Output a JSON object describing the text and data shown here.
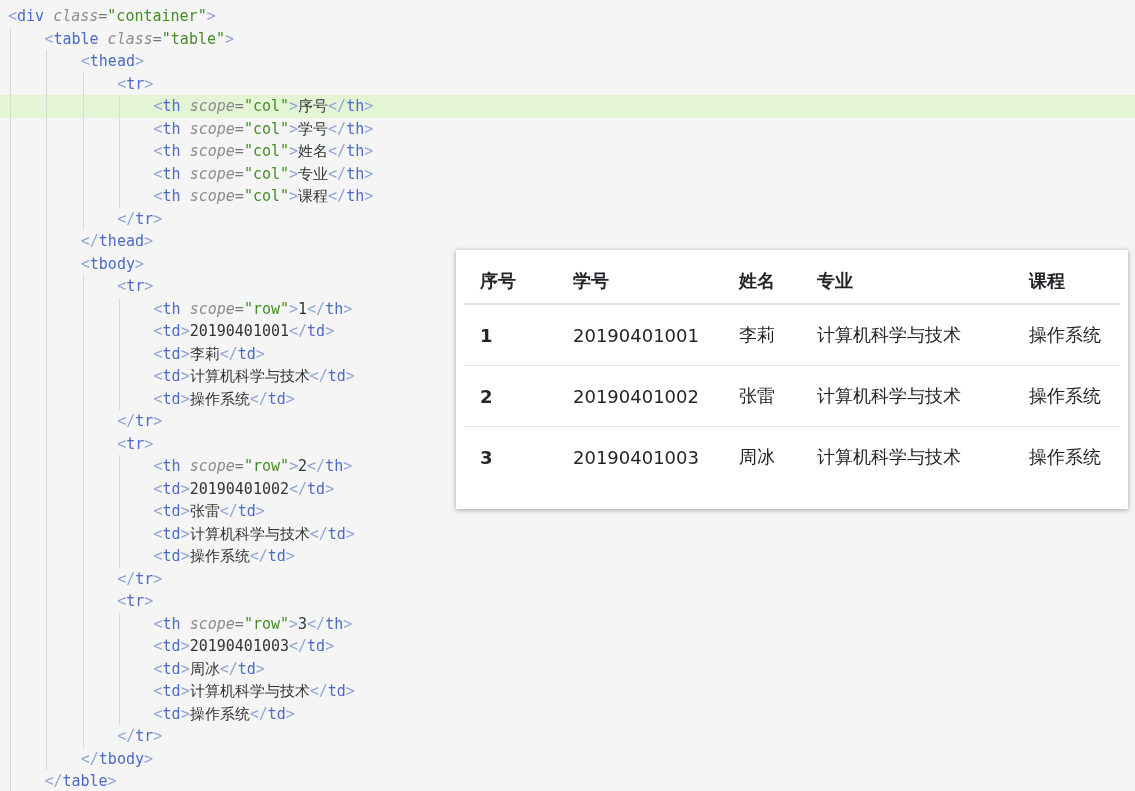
{
  "editor": {
    "lines": [
      {
        "highlighted": false,
        "tokens": [
          {
            "kind": "bracket",
            "text": "<"
          },
          {
            "kind": "tag",
            "text": "div"
          },
          {
            "kind": "attr",
            "text": " class"
          },
          {
            "kind": "eq",
            "text": "="
          },
          {
            "kind": "string",
            "text": "\"container\""
          },
          {
            "kind": "bracket",
            "text": ">"
          }
        ],
        "children": [
          {
            "highlighted": false,
            "tokens": [
              {
                "kind": "bracket",
                "text": "<"
              },
              {
                "kind": "tag",
                "text": "table"
              },
              {
                "kind": "attr",
                "text": " class"
              },
              {
                "kind": "eq",
                "text": "="
              },
              {
                "kind": "string",
                "text": "\"table\""
              },
              {
                "kind": "bracket",
                "text": ">"
              }
            ],
            "children": [
              {
                "highlighted": false,
                "tokens": [
                  {
                    "kind": "bracket",
                    "text": "<"
                  },
                  {
                    "kind": "tag",
                    "text": "thead"
                  },
                  {
                    "kind": "bracket",
                    "text": ">"
                  }
                ],
                "children": [
                  {
                    "highlighted": false,
                    "tokens": [
                      {
                        "kind": "bracket",
                        "text": "<"
                      },
                      {
                        "kind": "tag",
                        "text": "tr"
                      },
                      {
                        "kind": "bracket",
                        "text": ">"
                      }
                    ],
                    "children": [
                      {
                        "highlighted": true,
                        "tokens": [
                          {
                            "kind": "bracket",
                            "text": "<"
                          },
                          {
                            "kind": "tag",
                            "text": "th"
                          },
                          {
                            "kind": "attr",
                            "text": " scope"
                          },
                          {
                            "kind": "eq",
                            "text": "="
                          },
                          {
                            "kind": "string",
                            "text": "\"col\""
                          },
                          {
                            "kind": "bracket",
                            "text": ">"
                          },
                          {
                            "kind": "text",
                            "text": "序号"
                          },
                          {
                            "kind": "bracket",
                            "text": "</"
                          },
                          {
                            "kind": "tag",
                            "text": "th"
                          },
                          {
                            "kind": "bracket",
                            "text": ">"
                          }
                        ]
                      },
                      {
                        "highlighted": false,
                        "tokens": [
                          {
                            "kind": "bracket",
                            "text": "<"
                          },
                          {
                            "kind": "tag",
                            "text": "th"
                          },
                          {
                            "kind": "attr",
                            "text": " scope"
                          },
                          {
                            "kind": "eq",
                            "text": "="
                          },
                          {
                            "kind": "string",
                            "text": "\"col\""
                          },
                          {
                            "kind": "bracket",
                            "text": ">"
                          },
                          {
                            "kind": "text",
                            "text": "学号"
                          },
                          {
                            "kind": "bracket",
                            "text": "</"
                          },
                          {
                            "kind": "tag",
                            "text": "th"
                          },
                          {
                            "kind": "bracket",
                            "text": ">"
                          }
                        ]
                      },
                      {
                        "highlighted": false,
                        "tokens": [
                          {
                            "kind": "bracket",
                            "text": "<"
                          },
                          {
                            "kind": "tag",
                            "text": "th"
                          },
                          {
                            "kind": "attr",
                            "text": " scope"
                          },
                          {
                            "kind": "eq",
                            "text": "="
                          },
                          {
                            "kind": "string",
                            "text": "\"col\""
                          },
                          {
                            "kind": "bracket",
                            "text": ">"
                          },
                          {
                            "kind": "text",
                            "text": "姓名"
                          },
                          {
                            "kind": "bracket",
                            "text": "</"
                          },
                          {
                            "kind": "tag",
                            "text": "th"
                          },
                          {
                            "kind": "bracket",
                            "text": ">"
                          }
                        ]
                      },
                      {
                        "highlighted": false,
                        "tokens": [
                          {
                            "kind": "bracket",
                            "text": "<"
                          },
                          {
                            "kind": "tag",
                            "text": "th"
                          },
                          {
                            "kind": "attr",
                            "text": " scope"
                          },
                          {
                            "kind": "eq",
                            "text": "="
                          },
                          {
                            "kind": "string",
                            "text": "\"col\""
                          },
                          {
                            "kind": "bracket",
                            "text": ">"
                          },
                          {
                            "kind": "text",
                            "text": "专业"
                          },
                          {
                            "kind": "bracket",
                            "text": "</"
                          },
                          {
                            "kind": "tag",
                            "text": "th"
                          },
                          {
                            "kind": "bracket",
                            "text": ">"
                          }
                        ]
                      },
                      {
                        "highlighted": false,
                        "tokens": [
                          {
                            "kind": "bracket",
                            "text": "<"
                          },
                          {
                            "kind": "tag",
                            "text": "th"
                          },
                          {
                            "kind": "attr",
                            "text": " scope"
                          },
                          {
                            "kind": "eq",
                            "text": "="
                          },
                          {
                            "kind": "string",
                            "text": "\"col\""
                          },
                          {
                            "kind": "bracket",
                            "text": ">"
                          },
                          {
                            "kind": "text",
                            "text": "课程"
                          },
                          {
                            "kind": "bracket",
                            "text": "</"
                          },
                          {
                            "kind": "tag",
                            "text": "th"
                          },
                          {
                            "kind": "bracket",
                            "text": ">"
                          }
                        ]
                      }
                    ]
                  },
                  {
                    "highlighted": false,
                    "tokens": [
                      {
                        "kind": "bracket",
                        "text": "</"
                      },
                      {
                        "kind": "tag",
                        "text": "tr"
                      },
                      {
                        "kind": "bracket",
                        "text": ">"
                      }
                    ]
                  }
                ]
              },
              {
                "highlighted": false,
                "tokens": [
                  {
                    "kind": "bracket",
                    "text": "</"
                  },
                  {
                    "kind": "tag",
                    "text": "thead"
                  },
                  {
                    "kind": "bracket",
                    "text": ">"
                  }
                ]
              },
              {
                "highlighted": false,
                "tokens": [
                  {
                    "kind": "bracket",
                    "text": "<"
                  },
                  {
                    "kind": "tag",
                    "text": "tbody"
                  },
                  {
                    "kind": "bracket",
                    "text": ">"
                  }
                ],
                "children": [
                  {
                    "highlighted": false,
                    "tokens": [
                      {
                        "kind": "bracket",
                        "text": "<"
                      },
                      {
                        "kind": "tag",
                        "text": "tr"
                      },
                      {
                        "kind": "bracket",
                        "text": ">"
                      }
                    ],
                    "children": [
                      {
                        "highlighted": false,
                        "tokens": [
                          {
                            "kind": "bracket",
                            "text": "<"
                          },
                          {
                            "kind": "tag",
                            "text": "th"
                          },
                          {
                            "kind": "attr",
                            "text": " scope"
                          },
                          {
                            "kind": "eq",
                            "text": "="
                          },
                          {
                            "kind": "string",
                            "text": "\"row\""
                          },
                          {
                            "kind": "bracket",
                            "text": ">"
                          },
                          {
                            "kind": "text",
                            "text": "1"
                          },
                          {
                            "kind": "bracket",
                            "text": "</"
                          },
                          {
                            "kind": "tag",
                            "text": "th"
                          },
                          {
                            "kind": "bracket",
                            "text": ">"
                          }
                        ]
                      },
                      {
                        "highlighted": false,
                        "tokens": [
                          {
                            "kind": "bracket",
                            "text": "<"
                          },
                          {
                            "kind": "tag",
                            "text": "td"
                          },
                          {
                            "kind": "bracket",
                            "text": ">"
                          },
                          {
                            "kind": "text",
                            "text": "20190401001"
                          },
                          {
                            "kind": "bracket",
                            "text": "</"
                          },
                          {
                            "kind": "tag",
                            "text": "td"
                          },
                          {
                            "kind": "bracket",
                            "text": ">"
                          }
                        ]
                      },
                      {
                        "highlighted": false,
                        "tokens": [
                          {
                            "kind": "bracket",
                            "text": "<"
                          },
                          {
                            "kind": "tag",
                            "text": "td"
                          },
                          {
                            "kind": "bracket",
                            "text": ">"
                          },
                          {
                            "kind": "text",
                            "text": "李莉"
                          },
                          {
                            "kind": "bracket",
                            "text": "</"
                          },
                          {
                            "kind": "tag",
                            "text": "td"
                          },
                          {
                            "kind": "bracket",
                            "text": ">"
                          }
                        ]
                      },
                      {
                        "highlighted": false,
                        "tokens": [
                          {
                            "kind": "bracket",
                            "text": "<"
                          },
                          {
                            "kind": "tag",
                            "text": "td"
                          },
                          {
                            "kind": "bracket",
                            "text": ">"
                          },
                          {
                            "kind": "text",
                            "text": "计算机科学与技术"
                          },
                          {
                            "kind": "bracket",
                            "text": "</"
                          },
                          {
                            "kind": "tag",
                            "text": "td"
                          },
                          {
                            "kind": "bracket",
                            "text": ">"
                          }
                        ]
                      },
                      {
                        "highlighted": false,
                        "tokens": [
                          {
                            "kind": "bracket",
                            "text": "<"
                          },
                          {
                            "kind": "tag",
                            "text": "td"
                          },
                          {
                            "kind": "bracket",
                            "text": ">"
                          },
                          {
                            "kind": "text",
                            "text": "操作系统"
                          },
                          {
                            "kind": "bracket",
                            "text": "</"
                          },
                          {
                            "kind": "tag",
                            "text": "td"
                          },
                          {
                            "kind": "bracket",
                            "text": ">"
                          }
                        ]
                      }
                    ]
                  },
                  {
                    "highlighted": false,
                    "tokens": [
                      {
                        "kind": "bracket",
                        "text": "</"
                      },
                      {
                        "kind": "tag",
                        "text": "tr"
                      },
                      {
                        "kind": "bracket",
                        "text": ">"
                      }
                    ]
                  },
                  {
                    "highlighted": false,
                    "tokens": [
                      {
                        "kind": "bracket",
                        "text": "<"
                      },
                      {
                        "kind": "tag",
                        "text": "tr"
                      },
                      {
                        "kind": "bracket",
                        "text": ">"
                      }
                    ],
                    "children": [
                      {
                        "highlighted": false,
                        "tokens": [
                          {
                            "kind": "bracket",
                            "text": "<"
                          },
                          {
                            "kind": "tag",
                            "text": "th"
                          },
                          {
                            "kind": "attr",
                            "text": " scope"
                          },
                          {
                            "kind": "eq",
                            "text": "="
                          },
                          {
                            "kind": "string",
                            "text": "\"row\""
                          },
                          {
                            "kind": "bracket",
                            "text": ">"
                          },
                          {
                            "kind": "text",
                            "text": "2"
                          },
                          {
                            "kind": "bracket",
                            "text": "</"
                          },
                          {
                            "kind": "tag",
                            "text": "th"
                          },
                          {
                            "kind": "bracket",
                            "text": ">"
                          }
                        ]
                      },
                      {
                        "highlighted": false,
                        "tokens": [
                          {
                            "kind": "bracket",
                            "text": "<"
                          },
                          {
                            "kind": "tag",
                            "text": "td"
                          },
                          {
                            "kind": "bracket",
                            "text": ">"
                          },
                          {
                            "kind": "text",
                            "text": "20190401002"
                          },
                          {
                            "kind": "bracket",
                            "text": "</"
                          },
                          {
                            "kind": "tag",
                            "text": "td"
                          },
                          {
                            "kind": "bracket",
                            "text": ">"
                          }
                        ]
                      },
                      {
                        "highlighted": false,
                        "tokens": [
                          {
                            "kind": "bracket",
                            "text": "<"
                          },
                          {
                            "kind": "tag",
                            "text": "td"
                          },
                          {
                            "kind": "bracket",
                            "text": ">"
                          },
                          {
                            "kind": "text",
                            "text": "张雷"
                          },
                          {
                            "kind": "bracket",
                            "text": "</"
                          },
                          {
                            "kind": "tag",
                            "text": "td"
                          },
                          {
                            "kind": "bracket",
                            "text": ">"
                          }
                        ]
                      },
                      {
                        "highlighted": false,
                        "tokens": [
                          {
                            "kind": "bracket",
                            "text": "<"
                          },
                          {
                            "kind": "tag",
                            "text": "td"
                          },
                          {
                            "kind": "bracket",
                            "text": ">"
                          },
                          {
                            "kind": "text",
                            "text": "计算机科学与技术"
                          },
                          {
                            "kind": "bracket",
                            "text": "</"
                          },
                          {
                            "kind": "tag",
                            "text": "td"
                          },
                          {
                            "kind": "bracket",
                            "text": ">"
                          }
                        ]
                      },
                      {
                        "highlighted": false,
                        "tokens": [
                          {
                            "kind": "bracket",
                            "text": "<"
                          },
                          {
                            "kind": "tag",
                            "text": "td"
                          },
                          {
                            "kind": "bracket",
                            "text": ">"
                          },
                          {
                            "kind": "text",
                            "text": "操作系统"
                          },
                          {
                            "kind": "bracket",
                            "text": "</"
                          },
                          {
                            "kind": "tag",
                            "text": "td"
                          },
                          {
                            "kind": "bracket",
                            "text": ">"
                          }
                        ]
                      }
                    ]
                  },
                  {
                    "highlighted": false,
                    "tokens": [
                      {
                        "kind": "bracket",
                        "text": "</"
                      },
                      {
                        "kind": "tag",
                        "text": "tr"
                      },
                      {
                        "kind": "bracket",
                        "text": ">"
                      }
                    ]
                  },
                  {
                    "highlighted": false,
                    "tokens": [
                      {
                        "kind": "bracket",
                        "text": "<"
                      },
                      {
                        "kind": "tag",
                        "text": "tr"
                      },
                      {
                        "kind": "bracket",
                        "text": ">"
                      }
                    ],
                    "children": [
                      {
                        "highlighted": false,
                        "tokens": [
                          {
                            "kind": "bracket",
                            "text": "<"
                          },
                          {
                            "kind": "tag",
                            "text": "th"
                          },
                          {
                            "kind": "attr",
                            "text": " scope"
                          },
                          {
                            "kind": "eq",
                            "text": "="
                          },
                          {
                            "kind": "string",
                            "text": "\"row\""
                          },
                          {
                            "kind": "bracket",
                            "text": ">"
                          },
                          {
                            "kind": "text",
                            "text": "3"
                          },
                          {
                            "kind": "bracket",
                            "text": "</"
                          },
                          {
                            "kind": "tag",
                            "text": "th"
                          },
                          {
                            "kind": "bracket",
                            "text": ">"
                          }
                        ]
                      },
                      {
                        "highlighted": false,
                        "tokens": [
                          {
                            "kind": "bracket",
                            "text": "<"
                          },
                          {
                            "kind": "tag",
                            "text": "td"
                          },
                          {
                            "kind": "bracket",
                            "text": ">"
                          },
                          {
                            "kind": "text",
                            "text": "20190401003"
                          },
                          {
                            "kind": "bracket",
                            "text": "</"
                          },
                          {
                            "kind": "tag",
                            "text": "td"
                          },
                          {
                            "kind": "bracket",
                            "text": ">"
                          }
                        ]
                      },
                      {
                        "highlighted": false,
                        "tokens": [
                          {
                            "kind": "bracket",
                            "text": "<"
                          },
                          {
                            "kind": "tag",
                            "text": "td"
                          },
                          {
                            "kind": "bracket",
                            "text": ">"
                          },
                          {
                            "kind": "text",
                            "text": "周冰"
                          },
                          {
                            "kind": "bracket",
                            "text": "</"
                          },
                          {
                            "kind": "tag",
                            "text": "td"
                          },
                          {
                            "kind": "bracket",
                            "text": ">"
                          }
                        ]
                      },
                      {
                        "highlighted": false,
                        "tokens": [
                          {
                            "kind": "bracket",
                            "text": "<"
                          },
                          {
                            "kind": "tag",
                            "text": "td"
                          },
                          {
                            "kind": "bracket",
                            "text": ">"
                          },
                          {
                            "kind": "text",
                            "text": "计算机科学与技术"
                          },
                          {
                            "kind": "bracket",
                            "text": "</"
                          },
                          {
                            "kind": "tag",
                            "text": "td"
                          },
                          {
                            "kind": "bracket",
                            "text": ">"
                          }
                        ]
                      },
                      {
                        "highlighted": false,
                        "tokens": [
                          {
                            "kind": "bracket",
                            "text": "<"
                          },
                          {
                            "kind": "tag",
                            "text": "td"
                          },
                          {
                            "kind": "bracket",
                            "text": ">"
                          },
                          {
                            "kind": "text",
                            "text": "操作系统"
                          },
                          {
                            "kind": "bracket",
                            "text": "</"
                          },
                          {
                            "kind": "tag",
                            "text": "td"
                          },
                          {
                            "kind": "bracket",
                            "text": ">"
                          }
                        ]
                      }
                    ]
                  },
                  {
                    "highlighted": false,
                    "tokens": [
                      {
                        "kind": "bracket",
                        "text": "</"
                      },
                      {
                        "kind": "tag",
                        "text": "tr"
                      },
                      {
                        "kind": "bracket",
                        "text": ">"
                      }
                    ]
                  }
                ]
              },
              {
                "highlighted": false,
                "tokens": [
                  {
                    "kind": "bracket",
                    "text": "</"
                  },
                  {
                    "kind": "tag",
                    "text": "tbody"
                  },
                  {
                    "kind": "bracket",
                    "text": ">"
                  }
                ]
              }
            ]
          },
          {
            "highlighted": false,
            "tokens": [
              {
                "kind": "bracket",
                "text": "</"
              },
              {
                "kind": "tag",
                "text": "table"
              },
              {
                "kind": "bracket",
                "text": ">"
              }
            ]
          }
        ]
      }
    ]
  },
  "preview_table": {
    "columns": [
      "序号",
      "学号",
      "姓名",
      "专业",
      "课程"
    ],
    "rows": [
      {
        "cells": [
          "1",
          "20190401001",
          "李莉",
          "计算机科学与技术",
          "操作系统"
        ]
      },
      {
        "cells": [
          "2",
          "20190401002",
          "张雷",
          "计算机科学与技术",
          "操作系统"
        ]
      },
      {
        "cells": [
          "3",
          "20190401003",
          "周冰",
          "计算机科学与技术",
          "操作系统"
        ]
      }
    ]
  }
}
